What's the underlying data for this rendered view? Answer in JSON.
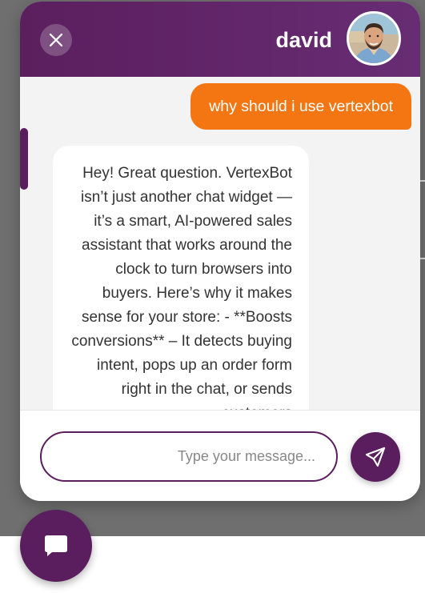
{
  "header": {
    "agent_name": "david",
    "close_icon": "close-icon",
    "avatar_icon": "avatar"
  },
  "messages": {
    "user": {
      "text": "why should i use vertexbot"
    },
    "bot": {
      "text": "Hey! Great question. VertexBot isn’t just another chat widget —it’s a smart, AI-powered sales assistant that works around the clock to turn browsers into buyers. Here’s why it makes sense for your store: - **Boosts conversions** – It detects buying intent, pops up an order form right in the chat, or sends customers"
    }
  },
  "composer": {
    "placeholder": "...Type your message",
    "value": "",
    "send_icon": "send-icon"
  },
  "launcher": {
    "icon": "chat-icon"
  },
  "colors": {
    "brand": "#5a1d5e",
    "user_bubble": "#f47613",
    "backdrop": "#6f6f6f"
  }
}
